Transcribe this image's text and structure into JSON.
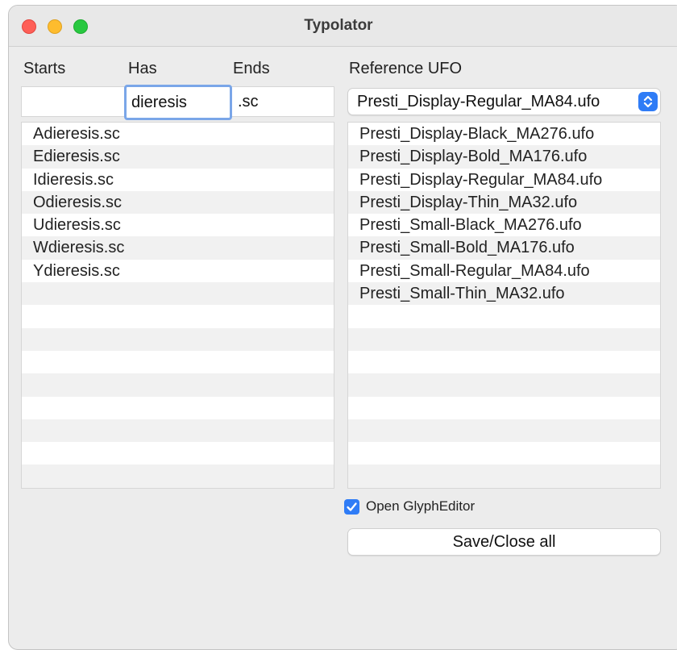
{
  "window": {
    "title": "Typolator"
  },
  "filters": {
    "starts_label": "Starts",
    "has_label": "Has",
    "ends_label": "Ends",
    "starts_value": "",
    "has_value": "dieresis",
    "ends_value": ".sc"
  },
  "glyph_list": {
    "items": [
      "Adieresis.sc",
      "Edieresis.sc",
      "Idieresis.sc",
      "Odieresis.sc",
      "Udieresis.sc",
      "Wdieresis.sc",
      "Ydieresis.sc",
      "",
      "",
      "",
      "",
      "",
      "",
      "",
      "",
      "",
      ""
    ]
  },
  "reference": {
    "label": "Reference UFO",
    "selected": "Presti_Display-Regular_MA84.ufo"
  },
  "ufo_list": {
    "items": [
      "Presti_Display-Black_MA276.ufo",
      "Presti_Display-Bold_MA176.ufo",
      "Presti_Display-Regular_MA84.ufo",
      "Presti_Display-Thin_MA32.ufo",
      "Presti_Small-Black_MA276.ufo",
      "Presti_Small-Bold_MA176.ufo",
      "Presti_Small-Regular_MA84.ufo",
      "Presti_Small-Thin_MA32.ufo",
      "",
      "",
      "",
      "",
      "",
      "",
      "",
      "",
      ""
    ]
  },
  "options": {
    "open_glyph_editor_label": "Open GlyphEditor",
    "open_glyph_editor_checked": true
  },
  "actions": {
    "save_close_label": "Save/Close all"
  },
  "colors": {
    "accent": "#2f7cf6",
    "focus_ring": "#7aa6e8",
    "close": "#fe5f57",
    "minimize": "#febc2e",
    "maximize": "#28c840"
  }
}
